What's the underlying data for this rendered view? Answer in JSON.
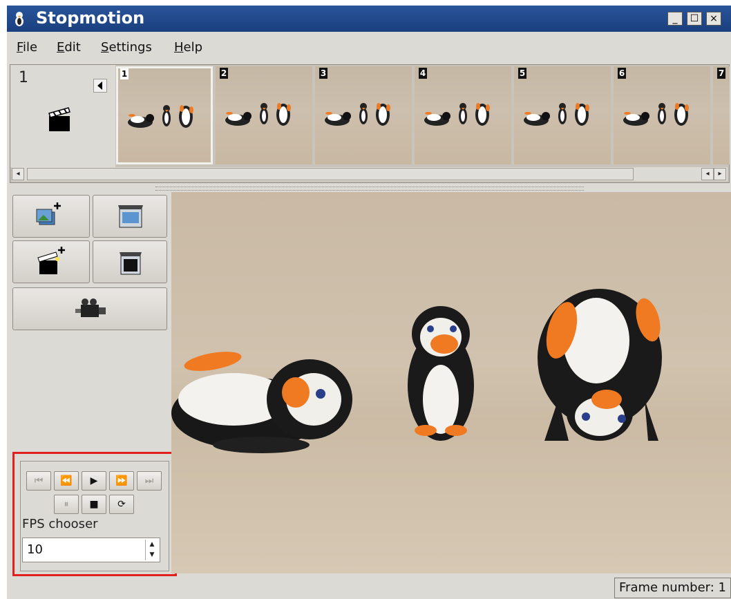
{
  "window": {
    "title": "Stopmotion",
    "controls": [
      "_",
      "☐",
      "×"
    ]
  },
  "menubar": [
    {
      "mn": "F",
      "rest": "ile"
    },
    {
      "mn": "E",
      "rest": "dit"
    },
    {
      "mn": "S",
      "rest": "ettings"
    },
    {
      "mn": "H",
      "rest": "elp"
    }
  ],
  "filmstrip": {
    "scene_number": "1",
    "frames": [
      "1",
      "2",
      "3",
      "4",
      "5",
      "6",
      "7"
    ],
    "selected_frame": "1"
  },
  "scroll": {
    "left_arrow": "◂",
    "right_arrow": "▸"
  },
  "tools": [
    {
      "icon": "add-frames-icon"
    },
    {
      "icon": "remove-frames-icon"
    },
    {
      "icon": "new-scene-icon"
    },
    {
      "icon": "remove-scene-icon"
    },
    {
      "icon": "camera-icon"
    }
  ],
  "playback": {
    "first": "⏮",
    "prev": "⏪",
    "play": "▶",
    "next": "⏩",
    "last": "⏭",
    "pause": "⏸",
    "stop": "■",
    "loop": "⟳"
  },
  "fps": {
    "label": "FPS chooser",
    "value": "10",
    "up": "▲",
    "down": "▼"
  },
  "status": {
    "text": "Frame number: 1"
  },
  "colors": {
    "titlebar": "#1f4a8a",
    "highlight": "#e01f1f",
    "penguin_beak": "#f07a22"
  }
}
